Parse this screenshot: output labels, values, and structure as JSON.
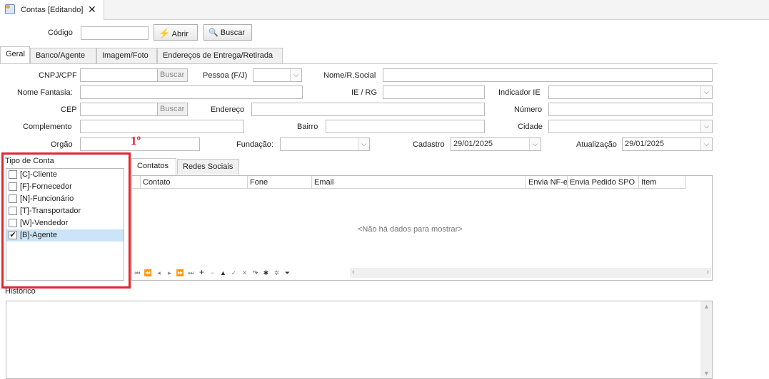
{
  "window": {
    "tab_title": "Contas [Editando]"
  },
  "toolbar": {
    "codigo_label": "Código",
    "codigo_value": "",
    "abrir_label": "Abrir",
    "buscar_label": "Buscar"
  },
  "tabs": [
    "Geral",
    "Banco/Agente",
    "Imagem/Foto",
    "Endereços de Entrega/Retirada"
  ],
  "form": {
    "cnpj_label": "CNPJ/CPF",
    "cnpj_buscar": "Buscar",
    "pessoa_label": "Pessoa (F/J)",
    "nome_social_label": "Nome/R.Social",
    "nome_fantasia_label": "Nome Fantasia:",
    "ie_rg_label": "IE / RG",
    "indicador_ie_label": "Indicador IE",
    "cep_label": "CEP",
    "cep_buscar": "Buscar",
    "endereco_label": "Endereço",
    "numero_label": "Número",
    "complemento_label": "Complemento",
    "bairro_label": "Bairro",
    "cidade_label": "Cidade",
    "orgao_label": "Orgão",
    "fundacao_label": "Fundação:",
    "cadastro_label": "Cadastro",
    "cadastro_value": "29/01/2025",
    "atualizacao_label": "Atualização",
    "atualizacao_value": "29/01/2025"
  },
  "annotation": {
    "text": "1º",
    "color": "#d9232d"
  },
  "tipo_conta": {
    "title": "Tipo de Conta",
    "items": [
      {
        "label": "[C]-Cliente",
        "checked": false
      },
      {
        "label": "[F]-Fornecedor",
        "checked": false
      },
      {
        "label": "[N]-Funcionário",
        "checked": false
      },
      {
        "label": "[T]-Transportador",
        "checked": false
      },
      {
        "label": "[W]-Vendedor",
        "checked": false
      },
      {
        "label": "[B]-Agente",
        "checked": true
      }
    ]
  },
  "contacts": {
    "tabs": [
      "Contatos",
      "Redes Sociais"
    ],
    "columns": [
      "Contato",
      "Fone",
      "Email",
      "Envia NF-e",
      "Envia Pedido SPO",
      "Item"
    ],
    "empty_text": "<Não há dados para mostrar>"
  },
  "historico": {
    "label": "Histórico"
  },
  "colors": {
    "highlight_border": "#e0262e",
    "selected_row": "#cce4f7"
  },
  "icons": {
    "checked": "✔",
    "dropdown": "chevron-down-icon"
  }
}
